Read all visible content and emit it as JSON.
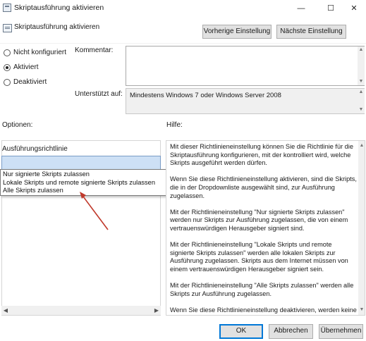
{
  "window": {
    "title": "Skriptausführung aktivieren",
    "minimize_glyph": "—",
    "maximize_glyph": "☐",
    "close_glyph": "✕"
  },
  "header": {
    "policy_title": "Skriptausführung aktivieren",
    "prev_setting": "Vorherige Einstellung",
    "next_setting": "Nächste Einstellung"
  },
  "state": {
    "options": [
      {
        "label": "Nicht konfiguriert",
        "selected": false
      },
      {
        "label": "Aktiviert",
        "selected": true
      },
      {
        "label": "Deaktiviert",
        "selected": false
      }
    ]
  },
  "comment": {
    "label": "Kommentar:",
    "value": ""
  },
  "supported": {
    "label": "Unterstützt auf:",
    "value": "Mindestens Windows 7 oder Windows Server 2008"
  },
  "options_section": {
    "label": "Optionen:",
    "field_label": "Ausführungsrichtlinie",
    "selected_value": "",
    "dropdown_items": [
      "Nur signierte Skripts zulassen",
      "Lokale Skripts und remote signierte Skripts zulassen",
      "Alle Skripts zulassen"
    ]
  },
  "help_section": {
    "label": "Hilfe:",
    "paragraphs": [
      "Mit dieser Richtlinieneinstellung können Sie die Richtlinie für die Skriptausführung konfigurieren, mit der kontrolliert wird, welche Skripts ausgeführt werden dürfen.",
      "Wenn Sie diese Richtlinieneinstellung aktivieren, sind die Skripts, die in der Dropdownliste ausgewählt sind, zur Ausführung zugelassen.",
      "Mit der Richtlinieneinstellung \"Nur signierte Skripts zulassen\" werden nur Skripts zur Ausführung zugelassen, die von einem vertrauenswürdigen Herausgeber signiert sind.",
      "Mit der Richtlinieneinstellung \"Lokale Skripts und remote signierte Skripts zulassen\" werden alle lokalen Skripts zur Ausführung zugelassen. Skripts aus dem Internet müssen von einem vertrauenswürdigen Herausgeber signiert sein.",
      "Mit der Richtlinieneinstellung \"Alle Skripts zulassen\" werden alle Skripts zur Ausführung zugelassen.",
      "Wenn Sie diese Richtlinieneinstellung deaktivieren, werden keine"
    ]
  },
  "footer": {
    "ok": "OK",
    "cancel": "Abbrechen",
    "apply": "Übernehmen"
  },
  "colors": {
    "annotation_arrow": "#c0392b",
    "selection_fill": "#cde0f5",
    "focus_border": "#0078d7"
  }
}
